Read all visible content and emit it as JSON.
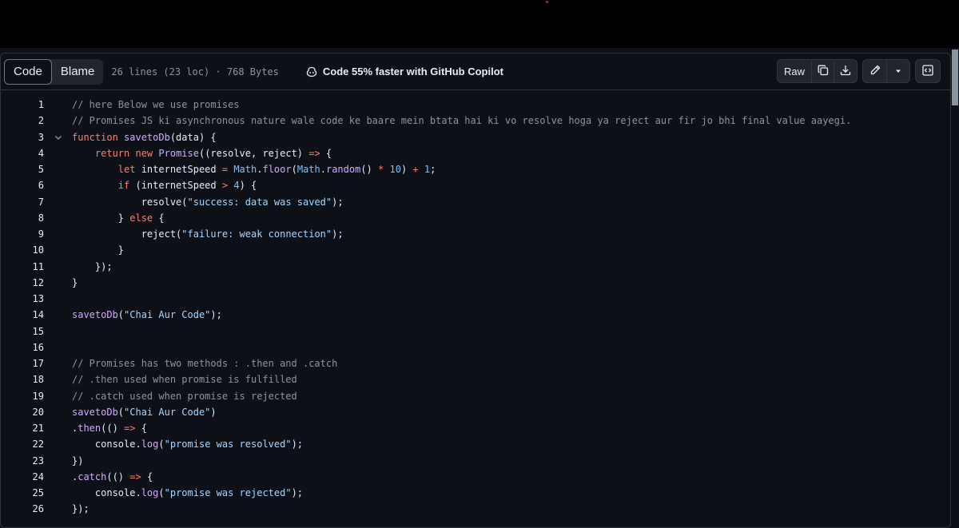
{
  "tabs": {
    "code": "Code",
    "blame": "Blame"
  },
  "file_meta": "26 lines (23 loc) · 768 Bytes",
  "copilot": {
    "label": "Code 55% faster with GitHub Copilot",
    "icon": "copilot-icon"
  },
  "toolbar": {
    "raw": "Raw",
    "copy_icon": "copy-icon",
    "download_icon": "download-icon",
    "edit_icon": "pencil-icon",
    "more_icon": "triangle-down-icon",
    "symbols_icon": "code-square-icon"
  },
  "code_lines": [
    {
      "n": "1",
      "fold": false,
      "tokens": [
        [
          "c",
          "// here Below we use promises"
        ]
      ]
    },
    {
      "n": "2",
      "fold": false,
      "tokens": [
        [
          "c",
          "// Promises JS ki asynchronous nature wale code ke baare mein btata hai ki vo resolve hoga ya reject aur fir jo bhi final value aayegi."
        ]
      ]
    },
    {
      "n": "3",
      "fold": true,
      "tokens": [
        [
          "k",
          "function "
        ],
        [
          "f",
          "savetoDb"
        ],
        [
          "p",
          "(data) {"
        ]
      ]
    },
    {
      "n": "4",
      "fold": false,
      "tokens": [
        [
          "p",
          "    "
        ],
        [
          "k",
          "return new "
        ],
        [
          "f",
          "Promise"
        ],
        [
          "p",
          "((resolve, reject) "
        ],
        [
          "o",
          "=>"
        ],
        [
          "p",
          " {"
        ]
      ]
    },
    {
      "n": "5",
      "fold": false,
      "tokens": [
        [
          "p",
          "        "
        ],
        [
          "k",
          "let "
        ],
        [
          "p",
          "internetSpeed "
        ],
        [
          "o",
          "="
        ],
        [
          "p",
          " "
        ],
        [
          "n",
          "Math"
        ],
        [
          "p",
          "."
        ],
        [
          "f",
          "floor"
        ],
        [
          "p",
          "("
        ],
        [
          "n",
          "Math"
        ],
        [
          "p",
          "."
        ],
        [
          "f",
          "random"
        ],
        [
          "p",
          "() "
        ],
        [
          "o",
          "*"
        ],
        [
          "p",
          " "
        ],
        [
          "n",
          "10"
        ],
        [
          "p",
          ") "
        ],
        [
          "o",
          "+"
        ],
        [
          "p",
          " "
        ],
        [
          "n",
          "1"
        ],
        [
          "p",
          ";"
        ]
      ]
    },
    {
      "n": "6",
      "fold": false,
      "tokens": [
        [
          "p",
          "        "
        ],
        [
          "k",
          "if "
        ],
        [
          "p",
          "(internetSpeed "
        ],
        [
          "o",
          ">"
        ],
        [
          "p",
          " "
        ],
        [
          "n",
          "4"
        ],
        [
          "p",
          ") {"
        ]
      ]
    },
    {
      "n": "7",
      "fold": false,
      "tokens": [
        [
          "p",
          "            resolve("
        ],
        [
          "s",
          "\"success: data was saved\""
        ],
        [
          "p",
          ");"
        ]
      ]
    },
    {
      "n": "8",
      "fold": false,
      "tokens": [
        [
          "p",
          "        } "
        ],
        [
          "k",
          "else "
        ],
        [
          "p",
          "{"
        ]
      ]
    },
    {
      "n": "9",
      "fold": false,
      "tokens": [
        [
          "p",
          "            reject("
        ],
        [
          "s",
          "\"failure: weak connection\""
        ],
        [
          "p",
          ");"
        ]
      ]
    },
    {
      "n": "10",
      "fold": false,
      "tokens": [
        [
          "p",
          "        }"
        ]
      ]
    },
    {
      "n": "11",
      "fold": false,
      "tokens": [
        [
          "p",
          "    });"
        ]
      ]
    },
    {
      "n": "12",
      "fold": false,
      "tokens": [
        [
          "p",
          "}"
        ]
      ]
    },
    {
      "n": "13",
      "fold": false,
      "tokens": []
    },
    {
      "n": "14",
      "fold": false,
      "tokens": [
        [
          "f",
          "savetoDb"
        ],
        [
          "p",
          "("
        ],
        [
          "s",
          "\"Chai Aur Code\""
        ],
        [
          "p",
          ");"
        ]
      ]
    },
    {
      "n": "15",
      "fold": false,
      "tokens": []
    },
    {
      "n": "16",
      "fold": false,
      "tokens": []
    },
    {
      "n": "17",
      "fold": false,
      "tokens": [
        [
          "c",
          "// Promises has two methods : .then and .catch"
        ]
      ]
    },
    {
      "n": "18",
      "fold": false,
      "tokens": [
        [
          "c",
          "// .then used when promise is fulfilled"
        ]
      ]
    },
    {
      "n": "19",
      "fold": false,
      "tokens": [
        [
          "c",
          "// .catch used when promise is rejected"
        ]
      ]
    },
    {
      "n": "20",
      "fold": false,
      "tokens": [
        [
          "f",
          "savetoDb"
        ],
        [
          "p",
          "("
        ],
        [
          "s",
          "\"Chai Aur Code\""
        ],
        [
          "p",
          ")"
        ]
      ]
    },
    {
      "n": "21",
      "fold": false,
      "tokens": [
        [
          "p",
          "."
        ],
        [
          "f",
          "then"
        ],
        [
          "p",
          "(() "
        ],
        [
          "o",
          "=>"
        ],
        [
          "p",
          " {"
        ]
      ]
    },
    {
      "n": "22",
      "fold": false,
      "tokens": [
        [
          "p",
          "    console."
        ],
        [
          "f",
          "log"
        ],
        [
          "p",
          "("
        ],
        [
          "s",
          "\"promise was resolved\""
        ],
        [
          "p",
          ");"
        ]
      ]
    },
    {
      "n": "23",
      "fold": false,
      "tokens": [
        [
          "p",
          "})"
        ]
      ]
    },
    {
      "n": "24",
      "fold": false,
      "tokens": [
        [
          "p",
          "."
        ],
        [
          "f",
          "catch"
        ],
        [
          "p",
          "(() "
        ],
        [
          "o",
          "=>"
        ],
        [
          "p",
          " {"
        ]
      ]
    },
    {
      "n": "25",
      "fold": false,
      "tokens": [
        [
          "p",
          "    console."
        ],
        [
          "f",
          "log"
        ],
        [
          "p",
          "("
        ],
        [
          "s",
          "\"promise was rejected\""
        ],
        [
          "p",
          ");"
        ]
      ]
    },
    {
      "n": "26",
      "fold": false,
      "tokens": [
        [
          "p",
          "});"
        ]
      ]
    }
  ]
}
